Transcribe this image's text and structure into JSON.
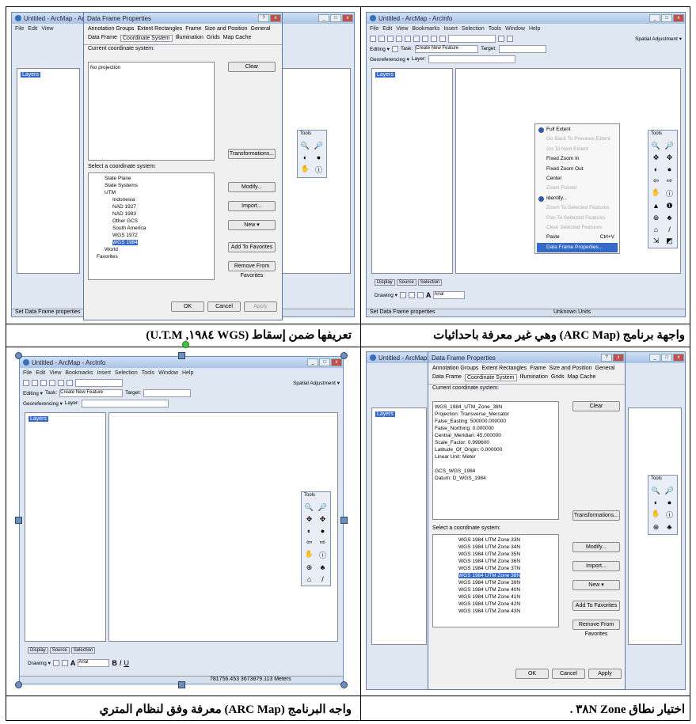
{
  "captions": {
    "top_right": "واجهة برنامج (ARC Map) وهي غير معرفة باحداثيات",
    "top_left": "تعريفها ضمن إسقاط (WGS ١٩٨٤, U.T.M)",
    "bottom_right": "اختيار نطاق Zone ٣٨N .",
    "bottom_left": "واجه البرنامج (ARC Map) معرفة وفق لنظام المتري"
  },
  "app": {
    "title": "Untitled - ArcMap - ArcInfo",
    "menu": [
      "File",
      "Edit",
      "View",
      "Bookmarks",
      "Insert",
      "Selection",
      "Tools",
      "Window",
      "Help"
    ],
    "editor_label": "Editing ▾",
    "task_label": "Task:",
    "task_value": "Create New Feature",
    "target_label": "Target:",
    "georef_label": "Georeferencing ▾",
    "layer_label": "Layer:",
    "spatial_adjust": "Spatial Adjustment ▾",
    "layers_root": "Layers",
    "tools_title": "Tools",
    "tools_icons": [
      "🔍",
      "🔎",
      "✥",
      "✥",
      "◐",
      "●",
      "⇦",
      "⇨",
      "✋",
      "ⓘ",
      "▲",
      "❶",
      "⊕",
      "♣",
      "⌂",
      "/",
      "⇲",
      "◩"
    ],
    "tabs_bottom": [
      "Display",
      "Source",
      "Selection"
    ],
    "drawing_label": "Drawing ▾",
    "font_value": "Arial",
    "status_undefined": "Set Data Frame properties",
    "status_coords": "781756.453  3673879.113 Meters",
    "status_units": "Unknown Units"
  },
  "context_menu": {
    "items": [
      {
        "label": "Full Extent",
        "disabled": false
      },
      {
        "label": "Go Back To Previous Extent",
        "disabled": true
      },
      {
        "label": "Go To Next Extent",
        "disabled": true
      },
      {
        "label": "Fixed Zoom In",
        "disabled": false
      },
      {
        "label": "Fixed Zoom Out",
        "disabled": false
      },
      {
        "label": "Center",
        "disabled": false
      },
      {
        "label": "Zoom Pointer",
        "disabled": true
      },
      {
        "label": "Identify...",
        "disabled": false
      },
      {
        "label": "Zoom To Selected Features",
        "disabled": true
      },
      {
        "label": "Pan To Selected Features",
        "disabled": true
      },
      {
        "label": "Clear Selected Features",
        "disabled": true
      },
      {
        "label": "Paste",
        "disabled": false,
        "shortcut": "Ctrl+V"
      },
      {
        "label": "Data Frame Properties...",
        "disabled": false,
        "highlighted": true
      }
    ]
  },
  "dialog": {
    "title": "Data Frame Properties",
    "tabs": [
      "Annotation Groups",
      "Extent Rectangles",
      "Frame",
      "Size and Position",
      "General",
      "Data Frame",
      "Coordinate System",
      "Illumination",
      "Grids",
      "Map Cache"
    ],
    "current_label": "Current coordinate system:",
    "no_projection": "No projection",
    "select_label": "Select a coordinate system:",
    "buttons": [
      "Clear",
      "Transformations...",
      "Modify...",
      "Import...",
      "New ▾",
      "Add To Favorites",
      "Remove From Favorites"
    ],
    "ok": "OK",
    "cancel": "Cancel",
    "apply": "Apply",
    "tree_top": [
      "State Plane",
      "State Systems",
      "UTM",
      "Indonesia",
      "NAD 1927",
      "NAD 1983",
      "Other GCS",
      "South America",
      "WGS 1972",
      "WGS 1984",
      "World",
      "Favorites"
    ],
    "current_details": [
      "WGS_1984_UTM_Zone_38N",
      "Projection: Transverse_Mercator",
      "False_Easting: 500000.000000",
      "False_Northing: 0.000000",
      "Central_Meridian: 45.000000",
      "Scale_Factor: 0.999600",
      "Latitude_Of_Origin: 0.000000",
      "Linear Unit: Meter",
      "",
      "GCS_WGS_1984",
      "Datum: D_WGS_1984"
    ],
    "zones": [
      "WGS 1984 UTM Zone 33N",
      "WGS 1984 UTM Zone 34N",
      "WGS 1984 UTM Zone 35N",
      "WGS 1984 UTM Zone 36N",
      "WGS 1984 UTM Zone 37N",
      "WGS 1984 UTM Zone 38N",
      "WGS 1984 UTM Zone 39N",
      "WGS 1984 UTM Zone 40N",
      "WGS 1984 UTM Zone 41N",
      "WGS 1984 UTM Zone 42N",
      "WGS 1984 UTM Zone 43N"
    ],
    "zone_selected_index": 5
  }
}
